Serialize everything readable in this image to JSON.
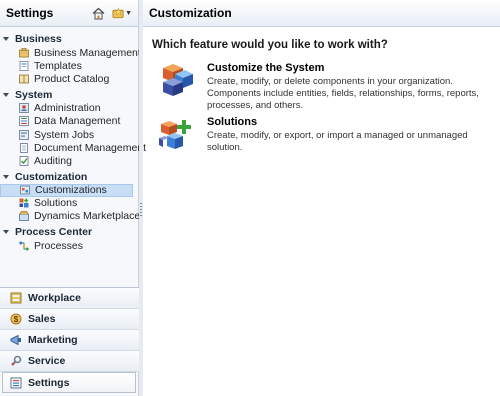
{
  "nav": {
    "title": "Settings",
    "groups": [
      {
        "title": "Business",
        "items": [
          {
            "label": "Business Management",
            "icon": "business-management-icon"
          },
          {
            "label": "Templates",
            "icon": "templates-icon"
          },
          {
            "label": "Product Catalog",
            "icon": "product-catalog-icon"
          }
        ]
      },
      {
        "title": "System",
        "items": [
          {
            "label": "Administration",
            "icon": "administration-icon"
          },
          {
            "label": "Data Management",
            "icon": "data-management-icon"
          },
          {
            "label": "System Jobs",
            "icon": "system-jobs-icon"
          },
          {
            "label": "Document Management",
            "icon": "document-management-icon"
          },
          {
            "label": "Auditing",
            "icon": "auditing-icon"
          }
        ]
      },
      {
        "title": "Customization",
        "items": [
          {
            "label": "Customizations",
            "icon": "customizations-icon",
            "selected": true
          },
          {
            "label": "Solutions",
            "icon": "solutions-icon"
          },
          {
            "label": "Dynamics Marketplace",
            "icon": "marketplace-icon"
          }
        ]
      },
      {
        "title": "Process Center",
        "items": [
          {
            "label": "Processes",
            "icon": "processes-icon"
          }
        ]
      }
    ],
    "wunderbar": [
      {
        "label": "Workplace",
        "icon": "workplace-icon"
      },
      {
        "label": "Sales",
        "icon": "sales-icon"
      },
      {
        "label": "Marketing",
        "icon": "marketing-icon"
      },
      {
        "label": "Service",
        "icon": "service-icon"
      },
      {
        "label": "Settings",
        "icon": "settings-icon",
        "active": true
      }
    ]
  },
  "content": {
    "title": "Customization",
    "question": "Which feature would you like to work with?",
    "features": [
      {
        "title": "Customize the System",
        "description": "Create, modify, or delete components in your organization. Components include entities, fields, relationships, forms, reports, processes, and others.",
        "icon": "customize-system-icon"
      },
      {
        "title": "Solutions",
        "description": "Create, modify, or export, or import a managed or unmanaged solution.",
        "icon": "solutions-feature-icon"
      }
    ]
  },
  "colors": {
    "selection": "#c7def6",
    "header_gradient_end": "#e8eef6",
    "nav_background": "#f6f8fb"
  }
}
